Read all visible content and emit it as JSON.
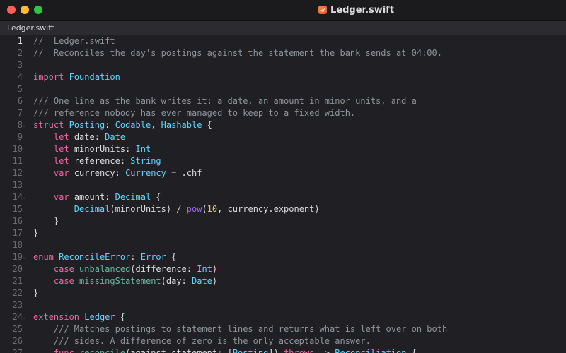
{
  "window": {
    "title": "Ledger.swift",
    "traffic_lights": {
      "close": "#ff5f57",
      "minimize": "#febc2e",
      "maximize": "#28c840"
    }
  },
  "tab": {
    "label": "Ledger.swift"
  },
  "editor": {
    "current_line": 1,
    "line_numbers": [
      "1",
      "2",
      "3",
      "4",
      "5",
      "6",
      "7",
      "8",
      "9",
      "10",
      "11",
      "12",
      "13",
      "14",
      "15",
      "16",
      "17",
      "18",
      "19",
      "20",
      "21",
      "22",
      "23",
      "24",
      "25",
      "26",
      "27"
    ],
    "fold_markers": [
      8,
      14,
      19,
      24,
      27
    ],
    "lines": [
      [
        {
          "t": "//  Ledger.swift",
          "c": "cm"
        }
      ],
      [
        {
          "t": "//  Reconciles the day's postings against the statement the bank sends at 04:00.",
          "c": "cm"
        }
      ],
      [],
      [
        {
          "t": "import",
          "c": "kw"
        },
        {
          "t": " ",
          "c": "pl"
        },
        {
          "t": "Foundation",
          "c": "ty"
        }
      ],
      [],
      [
        {
          "t": "/// One line as the bank writes it: a date, an amount in minor units, and a",
          "c": "cm"
        }
      ],
      [
        {
          "t": "/// reference nobody has ever managed to keep to a fixed width.",
          "c": "cm"
        }
      ],
      [
        {
          "t": "struct",
          "c": "kw"
        },
        {
          "t": " ",
          "c": "pl"
        },
        {
          "t": "Posting",
          "c": "ty"
        },
        {
          "t": ": ",
          "c": "pl"
        },
        {
          "t": "Codable",
          "c": "ty"
        },
        {
          "t": ", ",
          "c": "pl"
        },
        {
          "t": "Hashable",
          "c": "ty"
        },
        {
          "t": " {",
          "c": "pl"
        }
      ],
      [
        {
          "t": "    ",
          "c": "pl"
        },
        {
          "t": "let",
          "c": "kw"
        },
        {
          "t": " date: ",
          "c": "pl"
        },
        {
          "t": "Date",
          "c": "ty"
        }
      ],
      [
        {
          "t": "    ",
          "c": "pl"
        },
        {
          "t": "let",
          "c": "kw"
        },
        {
          "t": " minorUnits: ",
          "c": "pl"
        },
        {
          "t": "Int",
          "c": "ty"
        }
      ],
      [
        {
          "t": "    ",
          "c": "pl"
        },
        {
          "t": "let",
          "c": "kw"
        },
        {
          "t": " reference: ",
          "c": "pl"
        },
        {
          "t": "String",
          "c": "ty"
        }
      ],
      [
        {
          "t": "    ",
          "c": "pl"
        },
        {
          "t": "var",
          "c": "kw"
        },
        {
          "t": " currency: ",
          "c": "pl"
        },
        {
          "t": "Currency",
          "c": "ty"
        },
        {
          "t": " = .chf",
          "c": "pl"
        }
      ],
      [],
      [
        {
          "t": "    ",
          "c": "pl"
        },
        {
          "t": "var",
          "c": "kw"
        },
        {
          "t": " amount: ",
          "c": "pl"
        },
        {
          "t": "Decimal",
          "c": "ty"
        },
        {
          "t": " {",
          "c": "pl"
        }
      ],
      [
        {
          "t": "        ",
          "c": "pl"
        },
        {
          "t": "Decimal",
          "c": "ty"
        },
        {
          "t": "(minorUnits) / ",
          "c": "pl"
        },
        {
          "t": "pow",
          "c": "mod"
        },
        {
          "t": "(",
          "c": "pl"
        },
        {
          "t": "10",
          "c": "nm"
        },
        {
          "t": ", currency.exponent)",
          "c": "pl"
        }
      ],
      [
        {
          "t": "    }",
          "c": "pl"
        }
      ],
      [
        {
          "t": "}",
          "c": "pl"
        }
      ],
      [],
      [
        {
          "t": "enum",
          "c": "kw"
        },
        {
          "t": " ",
          "c": "pl"
        },
        {
          "t": "ReconcileError",
          "c": "ty"
        },
        {
          "t": ": ",
          "c": "pl"
        },
        {
          "t": "Error",
          "c": "ty"
        },
        {
          "t": " {",
          "c": "pl"
        }
      ],
      [
        {
          "t": "    ",
          "c": "pl"
        },
        {
          "t": "case",
          "c": "kw"
        },
        {
          "t": " ",
          "c": "pl"
        },
        {
          "t": "unbalanced",
          "c": "fn"
        },
        {
          "t": "(difference: ",
          "c": "pl"
        },
        {
          "t": "Int",
          "c": "ty"
        },
        {
          "t": ")",
          "c": "pl"
        }
      ],
      [
        {
          "t": "    ",
          "c": "pl"
        },
        {
          "t": "case",
          "c": "kw"
        },
        {
          "t": " ",
          "c": "pl"
        },
        {
          "t": "missingStatement",
          "c": "fn"
        },
        {
          "t": "(day: ",
          "c": "pl"
        },
        {
          "t": "Date",
          "c": "ty"
        },
        {
          "t": ")",
          "c": "pl"
        }
      ],
      [
        {
          "t": "}",
          "c": "pl"
        }
      ],
      [],
      [
        {
          "t": "extension",
          "c": "kw"
        },
        {
          "t": " ",
          "c": "pl"
        },
        {
          "t": "Ledger",
          "c": "ty"
        },
        {
          "t": " {",
          "c": "pl"
        }
      ],
      [
        {
          "t": "    /// Matches postings to statement lines and returns what is left over on both",
          "c": "cm"
        }
      ],
      [
        {
          "t": "    /// sides. A difference of zero is the only acceptable answer.",
          "c": "cm"
        }
      ],
      [
        {
          "t": "    ",
          "c": "pl"
        },
        {
          "t": "func",
          "c": "kw"
        },
        {
          "t": " ",
          "c": "pl"
        },
        {
          "t": "reconcile",
          "c": "fn"
        },
        {
          "t": "(against statement: [",
          "c": "pl"
        },
        {
          "t": "Posting",
          "c": "ty"
        },
        {
          "t": "]) ",
          "c": "pl"
        },
        {
          "t": "throws",
          "c": "kw"
        },
        {
          "t": " -> ",
          "c": "pl"
        },
        {
          "t": "Reconciliation",
          "c": "ty"
        },
        {
          "t": " {",
          "c": "pl"
        }
      ]
    ]
  },
  "colors": {
    "background": "#1f1f24",
    "comment": "#8c949c",
    "keyword": "#fc5fa3",
    "type": "#5dd8ff",
    "function": "#67b7a4",
    "number": "#d9c97c",
    "plain": "#dcdcdf"
  }
}
